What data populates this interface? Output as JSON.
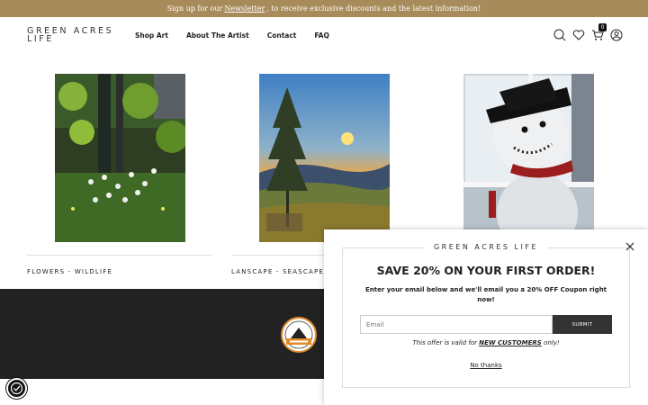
{
  "announcement": {
    "prefix": "Sign up for our",
    "link": "Newsletter",
    "suffix": ", to receive exclusive discounts and the latest information!"
  },
  "header": {
    "logo_line1": "GREEN ACRES",
    "logo_line2": "LIFE",
    "nav": [
      "Shop Art",
      "About The Artist",
      "Contact",
      "FAQ"
    ],
    "icons": [
      "search-icon",
      "heart-icon",
      "cart-icon",
      "account-icon"
    ],
    "cart_count": "0"
  },
  "products": [
    {
      "label": "FLOWERS - WILDLIFE",
      "art": "forest-flowers-painting"
    },
    {
      "label": "LANSCAPE - SEASCAPE",
      "art": "sunset-tree-painting"
    },
    {
      "label": "",
      "art": "snowman-window-painting"
    }
  ],
  "popup": {
    "brand": "GREEN ACRES LIFE",
    "headline": "SAVE 20% ON YOUR FIRST ORDER!",
    "subtext": "Enter your email below and we'll email you a 20% OFF Coupon right now!",
    "email_placeholder": "Email",
    "submit_label": "SUBMIT",
    "valid_prefix": "This offer is valid for ",
    "valid_emph": "NEW CUSTOMERS",
    "valid_suffix": " only!",
    "no_thanks": "No thanks",
    "close_icon": "close-icon"
  },
  "colors": {
    "announce_bg": "#a88b5a",
    "footer_bg": "#222222",
    "submit_bg": "#333333"
  }
}
